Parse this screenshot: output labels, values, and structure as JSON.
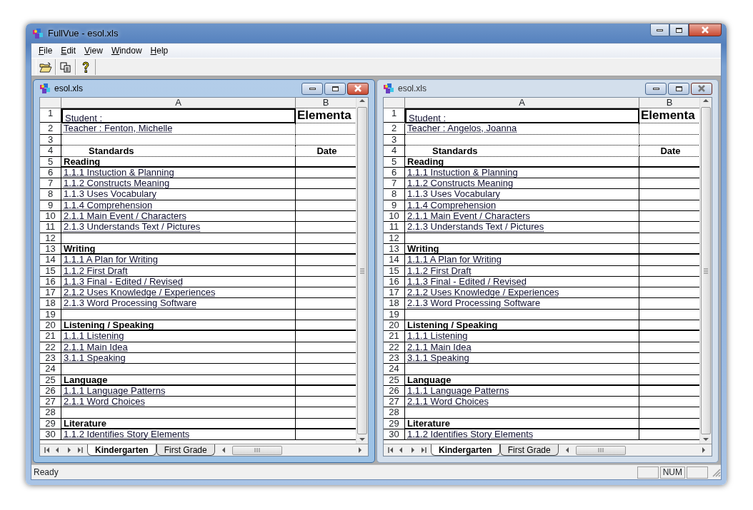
{
  "window": {
    "title": "FullVue - esol.xls"
  },
  "menu": [
    {
      "label": "File"
    },
    {
      "label": "Edit"
    },
    {
      "label": "View"
    },
    {
      "label": "Window"
    },
    {
      "label": "Help"
    }
  ],
  "documents": [
    {
      "title": "esol.xls",
      "active": true,
      "columns": [
        "A",
        "B"
      ],
      "rows": [
        {
          "number": "1",
          "kind": "title",
          "a": "Student :",
          "b": "Elementa"
        },
        {
          "number": "2",
          "kind": "info",
          "a": "Teacher : Fenton, Michelle"
        },
        {
          "number": "3",
          "kind": "blank"
        },
        {
          "number": "4",
          "kind": "header",
          "a": "Standards",
          "b": "Date"
        },
        {
          "number": "5",
          "kind": "heading",
          "a": "Reading"
        },
        {
          "number": "6",
          "kind": "item",
          "a": "1.1.1 Instuction & Planning"
        },
        {
          "number": "7",
          "kind": "item",
          "a": "1.1.2 Constructs Meaning"
        },
        {
          "number": "8",
          "kind": "item",
          "a": "1.1.3 Uses Vocabulary"
        },
        {
          "number": "9",
          "kind": "item",
          "a": "1.1.4 Comprehension"
        },
        {
          "number": "10",
          "kind": "item",
          "a": "2.1.1 Main Event / Characters"
        },
        {
          "number": "11",
          "kind": "item",
          "a": "2.1.3 Understands Text / Pictures"
        },
        {
          "number": "12",
          "kind": "blank"
        },
        {
          "number": "13",
          "kind": "heading",
          "a": "Writing"
        },
        {
          "number": "14",
          "kind": "item",
          "a": "1.1.1 A Plan for Writing"
        },
        {
          "number": "15",
          "kind": "item",
          "a": "1.1.2 First Draft"
        },
        {
          "number": "16",
          "kind": "item",
          "a": "1.1.3 Final - Edited / Revised"
        },
        {
          "number": "17",
          "kind": "item",
          "a": "2.1.2 Uses Knowledge / Experiences"
        },
        {
          "number": "18",
          "kind": "item",
          "a": "2.1.3 Word Processing Software"
        },
        {
          "number": "19",
          "kind": "blank"
        },
        {
          "number": "20",
          "kind": "heading",
          "a": "Listening / Speaking"
        },
        {
          "number": "21",
          "kind": "item",
          "a": "1.1.1 Listening"
        },
        {
          "number": "22",
          "kind": "item",
          "a": "2.1.1 Main Idea"
        },
        {
          "number": "23",
          "kind": "item",
          "a": "3.1.1 Speaking"
        },
        {
          "number": "24",
          "kind": "blank"
        },
        {
          "number": "25",
          "kind": "heading",
          "a": "Language"
        },
        {
          "number": "26",
          "kind": "item",
          "a": "1.1.1 Language Patterns"
        },
        {
          "number": "27",
          "kind": "item",
          "a": "2.1.1 Word Choices"
        },
        {
          "number": "28",
          "kind": "blank"
        },
        {
          "number": "29",
          "kind": "heading",
          "a": "Literature"
        },
        {
          "number": "30",
          "kind": "item",
          "a": "1.1.2 Identifies Story Elements"
        }
      ],
      "sheet_tabs": [
        {
          "label": "Kindergarten",
          "selected": true
        },
        {
          "label": "First Grade",
          "selected": false
        }
      ]
    },
    {
      "title": "esol.xls",
      "active": false,
      "columns": [
        "A",
        "B"
      ],
      "rows": [
        {
          "number": "1",
          "kind": "title",
          "a": "Student :",
          "b": "Elementa"
        },
        {
          "number": "2",
          "kind": "info",
          "a": "Teacher : Angelos, Joanna"
        },
        {
          "number": "3",
          "kind": "blank"
        },
        {
          "number": "4",
          "kind": "header",
          "a": "Standards",
          "b": "Date"
        },
        {
          "number": "5",
          "kind": "heading",
          "a": "Reading"
        },
        {
          "number": "6",
          "kind": "item",
          "a": "1.1.1 Instuction & Planning"
        },
        {
          "number": "7",
          "kind": "item",
          "a": "1.1.2 Constructs Meaning"
        },
        {
          "number": "8",
          "kind": "item",
          "a": "1.1.3 Uses Vocabulary"
        },
        {
          "number": "9",
          "kind": "item",
          "a": "1.1.4 Comprehension"
        },
        {
          "number": "10",
          "kind": "item",
          "a": "2.1.1 Main Event / Characters"
        },
        {
          "number": "11",
          "kind": "item",
          "a": "2.1.3 Understands Text / Pictures"
        },
        {
          "number": "12",
          "kind": "blank"
        },
        {
          "number": "13",
          "kind": "heading",
          "a": "Writing"
        },
        {
          "number": "14",
          "kind": "item",
          "a": "1.1.1 A Plan for Writing"
        },
        {
          "number": "15",
          "kind": "item",
          "a": "1.1.2 First Draft"
        },
        {
          "number": "16",
          "kind": "item",
          "a": "1.1.3 Final - Edited / Revised"
        },
        {
          "number": "17",
          "kind": "item",
          "a": "2.1.2 Uses Knowledge / Experiences"
        },
        {
          "number": "18",
          "kind": "item",
          "a": "2.1.3 Word Processing Software"
        },
        {
          "number": "19",
          "kind": "blank"
        },
        {
          "number": "20",
          "kind": "heading",
          "a": "Listening / Speaking"
        },
        {
          "number": "21",
          "kind": "item",
          "a": "1.1.1 Listening"
        },
        {
          "number": "22",
          "kind": "item",
          "a": "2.1.1 Main Idea"
        },
        {
          "number": "23",
          "kind": "item",
          "a": "3.1.1 Speaking"
        },
        {
          "number": "24",
          "kind": "blank"
        },
        {
          "number": "25",
          "kind": "heading",
          "a": "Language"
        },
        {
          "number": "26",
          "kind": "item",
          "a": "1.1.1 Language Patterns"
        },
        {
          "number": "27",
          "kind": "item",
          "a": "2.1.1 Word Choices"
        },
        {
          "number": "28",
          "kind": "blank"
        },
        {
          "number": "29",
          "kind": "heading",
          "a": "Literature"
        },
        {
          "number": "30",
          "kind": "item",
          "a": "1.1.2 Identifies Story Elements"
        }
      ],
      "sheet_tabs": [
        {
          "label": "Kindergarten",
          "selected": true
        },
        {
          "label": "First Grade",
          "selected": false
        }
      ]
    }
  ],
  "status_bar": {
    "text": "Ready",
    "indicators": [
      "NUM"
    ]
  }
}
